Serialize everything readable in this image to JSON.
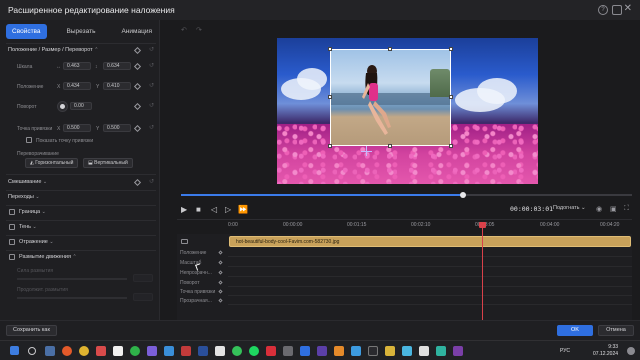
{
  "window": {
    "title": "Расширенное редактирование наложения"
  },
  "tabs": [
    {
      "label": "Свойства",
      "active": true
    },
    {
      "label": "Вырезать",
      "active": false
    },
    {
      "label": "Анимация",
      "active": false
    }
  ],
  "properties": {
    "section_title": "Положение / Размер / Переворот",
    "scale": {
      "label": "Шкала",
      "x_axis": "↔",
      "x": "0.463",
      "y_axis": "↕",
      "y": "0.634"
    },
    "position": {
      "label": "Положение",
      "x_axis": "X",
      "x": "0.434",
      "y_axis": "Y",
      "y": "0.410"
    },
    "rotation": {
      "label": "Поворот",
      "value": "0.00"
    },
    "anchor": {
      "label": "Точка привязки",
      "x_axis": "X",
      "x": "0.500",
      "y_axis": "Y",
      "y": "0.500"
    },
    "show_anchor_label": "Показать точку привязки",
    "flip_title": "Переворачивание",
    "flip_horizontal": "Горизонтальный",
    "flip_vertical": "Вертикальный"
  },
  "sections": {
    "blending": "Смешивание",
    "transitions": "Переходы",
    "border": "Граница",
    "shadow": "Тень",
    "reflection": "Отражение",
    "motion_blur": "Размытие движения",
    "blur_strength": "Сила размытия",
    "blur_length": "Продолжит. размытия"
  },
  "player": {
    "timecode": "00:00:03:01",
    "fit_label": "Подогнать",
    "progress_fraction": 0.625
  },
  "timeline": {
    "ruler": [
      "0:00",
      "00:00:00",
      "00:01:15",
      "00:02:10",
      "00:03:05",
      "00:04:00",
      "00:04:20"
    ],
    "clip_name": "hot-beautiful-body-cool-Favim.com-582730.jpg",
    "playhead_fraction": 0.628,
    "keyframe_rows": [
      "Положение",
      "Масштаб",
      "Непрозрачн...",
      "Поворот",
      "Точка привязки",
      "Прозрачная..."
    ]
  },
  "footer": {
    "save_as": "Сохранить как",
    "ok": "OK",
    "cancel": "Отмена"
  },
  "taskbar": {
    "lang": "РУС",
    "time": "9:33",
    "date": "07.12.2024"
  },
  "colors": {
    "accent": "#2f6fe0",
    "playhead": "#d9414a",
    "clip": "#c8a15a"
  }
}
